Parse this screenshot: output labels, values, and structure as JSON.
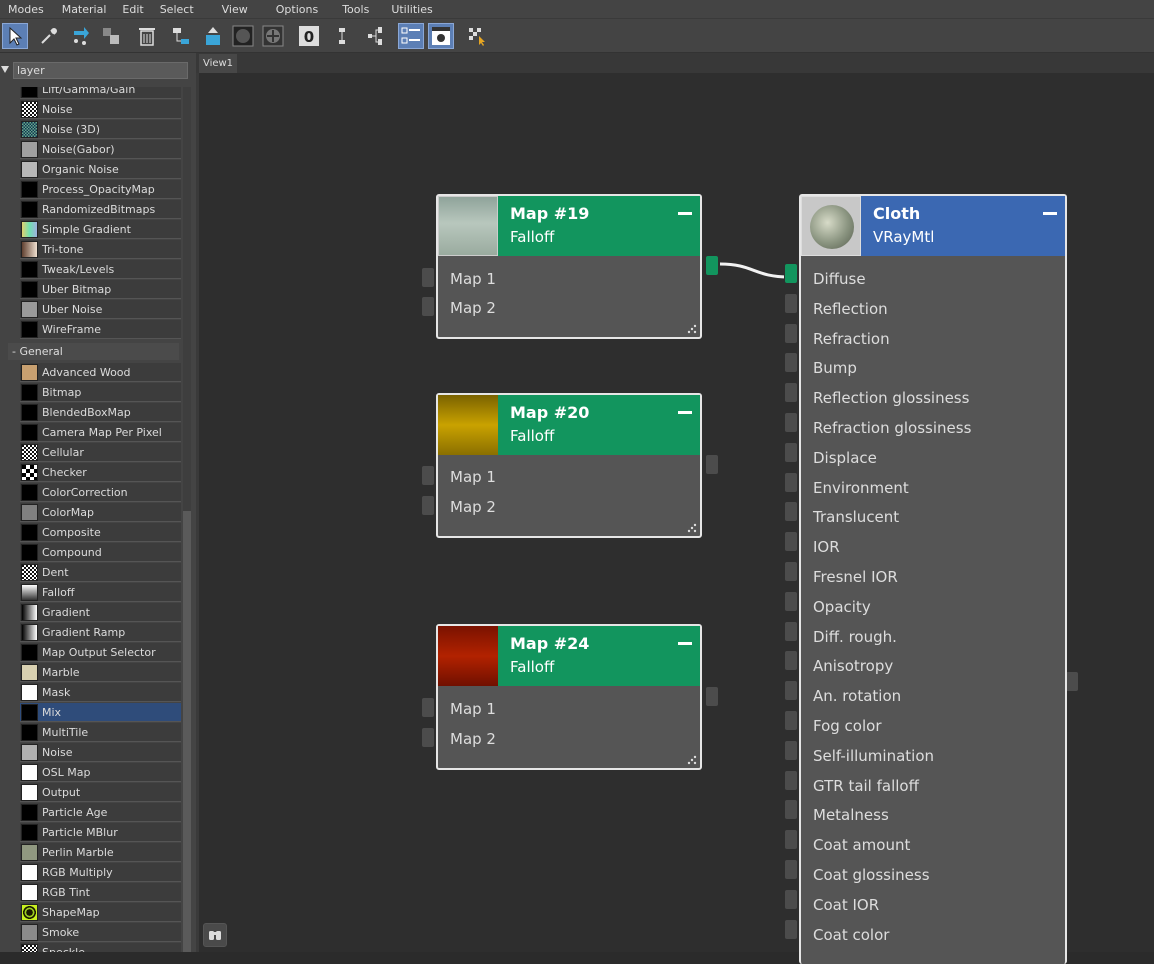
{
  "menu": [
    "Modes",
    "Material",
    "Edit",
    "Select",
    "View",
    "Options",
    "Tools",
    "Utilities"
  ],
  "search": {
    "value": "layer"
  },
  "tabs": {
    "view1": "View1"
  },
  "list_top": [
    {
      "label": "Lift/Gamma/Gain",
      "swatch": "#000000"
    },
    {
      "label": "Noise",
      "swatch": "noise"
    },
    {
      "label": "Noise (3D)",
      "swatch": "noise3d"
    },
    {
      "label": "Noise(Gabor)",
      "swatch": "#a0a0a0"
    },
    {
      "label": "Organic Noise",
      "swatch": "#b8b8b8"
    },
    {
      "label": "Process_OpacityMap",
      "swatch": "#000000"
    },
    {
      "label": "RandomizedBitmaps",
      "swatch": "#000000"
    },
    {
      "label": "Simple Gradient",
      "swatch": "gradient-color"
    },
    {
      "label": "Tri-tone",
      "swatch": "tritone"
    },
    {
      "label": "Tweak/Levels",
      "swatch": "#000000"
    },
    {
      "label": "Uber Bitmap",
      "swatch": "#000000"
    },
    {
      "label": "Uber Noise",
      "swatch": "#9a9a9a"
    },
    {
      "label": "WireFrame",
      "swatch": "#000000"
    }
  ],
  "category": "- General",
  "list_general": [
    {
      "label": "Advanced Wood",
      "swatch": "#c8a070"
    },
    {
      "label": "Bitmap",
      "swatch": "#000000"
    },
    {
      "label": "BlendedBoxMap",
      "swatch": "#000000"
    },
    {
      "label": "Camera Map Per Pixel",
      "swatch": "#000000"
    },
    {
      "label": "Cellular",
      "swatch": "noise"
    },
    {
      "label": "Checker",
      "swatch": "checker"
    },
    {
      "label": "ColorCorrection",
      "swatch": "#000000"
    },
    {
      "label": "ColorMap",
      "swatch": "#808080"
    },
    {
      "label": "Composite",
      "swatch": "#000000"
    },
    {
      "label": "Compound",
      "swatch": "#000000"
    },
    {
      "label": "Dent",
      "swatch": "noise"
    },
    {
      "label": "Falloff",
      "swatch": "falloff"
    },
    {
      "label": "Gradient",
      "swatch": "gradient-gray"
    },
    {
      "label": "Gradient Ramp",
      "swatch": "gradient-gray"
    },
    {
      "label": "Map Output Selector",
      "swatch": "#000000"
    },
    {
      "label": "Marble",
      "swatch": "#d8d0b0"
    },
    {
      "label": "Mask",
      "swatch": "#ffffff"
    },
    {
      "label": "Mix",
      "swatch": "#000000",
      "selected": true
    },
    {
      "label": "MultiTile",
      "swatch": "#000000"
    },
    {
      "label": "Noise",
      "swatch": "#b0b0b0"
    },
    {
      "label": "OSL Map",
      "swatch": "#ffffff"
    },
    {
      "label": "Output",
      "swatch": "#ffffff"
    },
    {
      "label": "Particle Age",
      "swatch": "#000000"
    },
    {
      "label": "Particle MBlur",
      "swatch": "#000000"
    },
    {
      "label": "Perlin Marble",
      "swatch": "#909880"
    },
    {
      "label": "RGB Multiply",
      "swatch": "#ffffff"
    },
    {
      "label": "RGB Tint",
      "swatch": "#ffffff"
    },
    {
      "label": "ShapeMap",
      "swatch": "shapemap"
    },
    {
      "label": "Smoke",
      "swatch": "#8a8a8a"
    },
    {
      "label": "Speckle",
      "swatch": "noise"
    }
  ],
  "nodes": {
    "map19": {
      "title": "Map #19",
      "subtitle": "Falloff",
      "slot1": "Map 1",
      "slot2": "Map 2"
    },
    "map20": {
      "title": "Map #20",
      "subtitle": "Falloff",
      "slot1": "Map 1",
      "slot2": "Map 2"
    },
    "map24": {
      "title": "Map #24",
      "subtitle": "Falloff",
      "slot1": "Map 1",
      "slot2": "Map 2"
    },
    "cloth": {
      "title": "Cloth",
      "subtitle": "VRayMtl",
      "slots": [
        "Diffuse",
        "Reflection",
        "Refraction",
        "Bump",
        "Reflection glossiness",
        "Refraction glossiness",
        "Displace",
        "Environment",
        "Translucent",
        "IOR",
        "Fresnel IOR",
        "Opacity",
        "Diff. rough.",
        "Anisotropy",
        "An. rotation",
        "Fog color",
        "Self-illumination",
        "GTR tail falloff",
        "Metalness",
        "Coat amount",
        "Coat glossiness",
        "Coat IOR",
        "Coat color"
      ]
    }
  },
  "colors": {
    "node_green": "#12955e",
    "node_blue": "#3b68b2",
    "selection": "#2f4c7a"
  }
}
